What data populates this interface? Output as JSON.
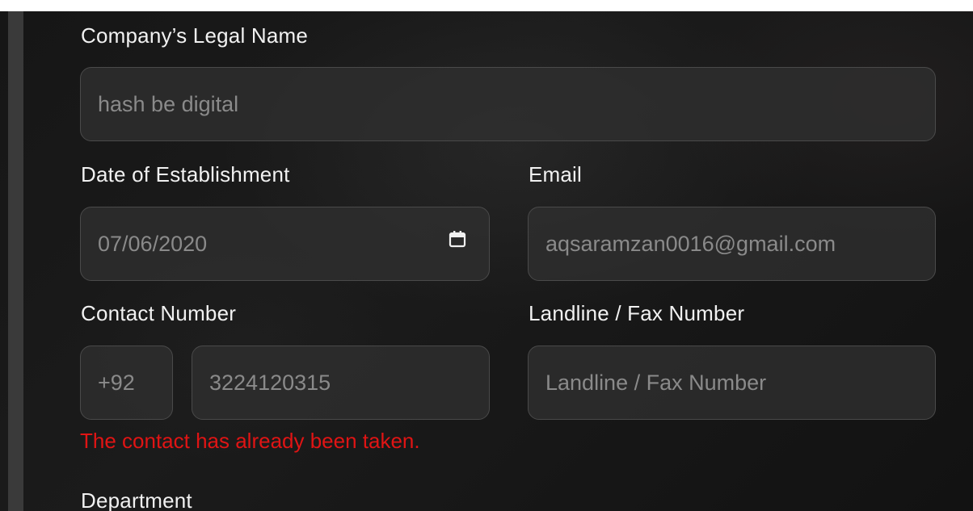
{
  "form": {
    "legal_name": {
      "label": "Company’s Legal Name",
      "placeholder": "hash be digital"
    },
    "date_of_establishment": {
      "label": "Date of Establishment",
      "value": "07/06/2020",
      "icon": "calendar-icon"
    },
    "email": {
      "label": "Email",
      "value": "aqsaramzan0016@gmail.com"
    },
    "contact_number": {
      "label": "Contact Number",
      "country_code": "+92",
      "value": "3224120315",
      "error": "The contact has already been taken."
    },
    "landline": {
      "label": "Landline / Fax Number",
      "placeholder": "Landline / Fax Number"
    },
    "department": {
      "label": "Department"
    }
  },
  "colors": {
    "background": "#141414",
    "input_bg": "#303030",
    "input_border": "#4a4a4a",
    "label_text": "#f1f1f1",
    "input_text": "#8a8a8a",
    "error": "#e01414"
  }
}
